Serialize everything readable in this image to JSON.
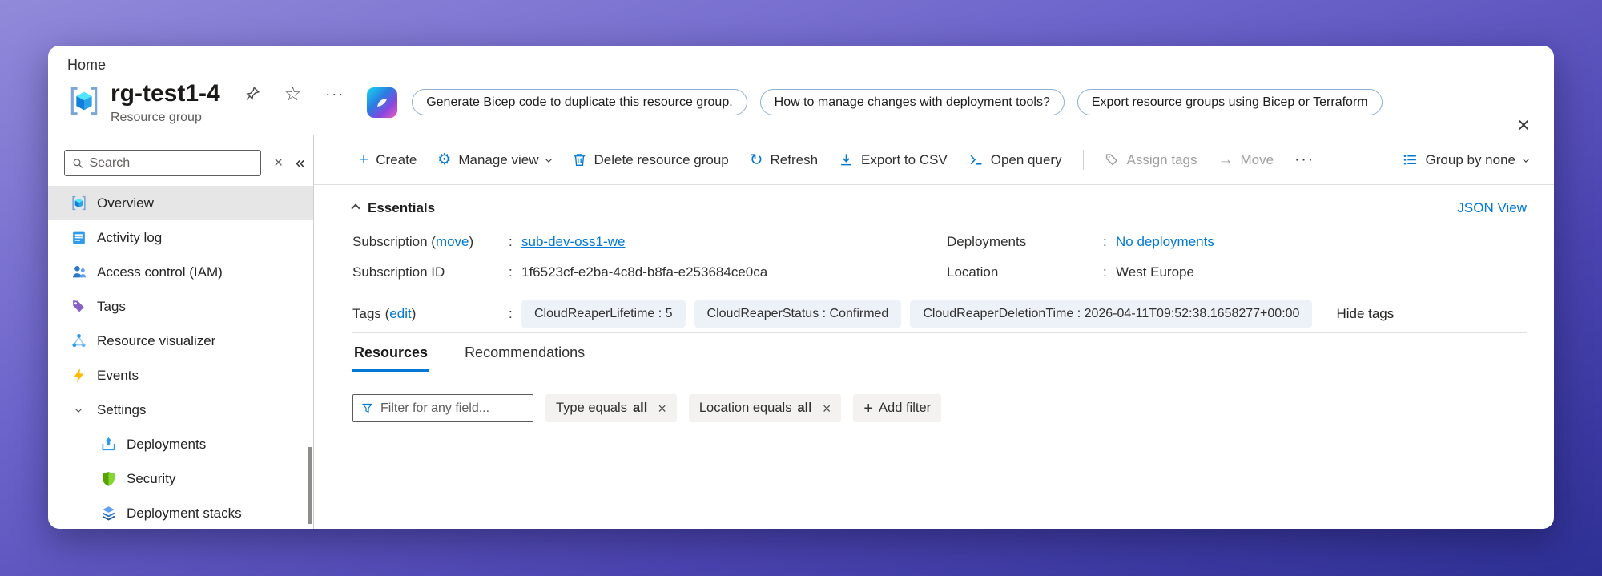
{
  "window": {
    "close_glyph": "×"
  },
  "breadcrumb": {
    "label": "Home"
  },
  "header": {
    "title": "rg-test1-4",
    "subtitle": "Resource group",
    "chips": [
      "Generate Bicep code to duplicate this resource group.",
      "How to manage changes with deployment tools?",
      "Export resource groups using Bicep or Terraform"
    ]
  },
  "glyphs": {
    "plus": "+",
    "gear": "⚙",
    "refresh": "↻",
    "star": "☆",
    "more": "···",
    "collapse": "«",
    "clear": "×",
    "move_arrow": "→"
  },
  "sidebar": {
    "search_placeholder": "Search",
    "items": [
      {
        "label": "Overview"
      },
      {
        "label": "Activity log"
      },
      {
        "label": "Access control (IAM)"
      },
      {
        "label": "Tags"
      },
      {
        "label": "Resource visualizer"
      },
      {
        "label": "Events"
      },
      {
        "label": "Settings"
      },
      {
        "label": "Deployments"
      },
      {
        "label": "Security"
      },
      {
        "label": "Deployment stacks"
      }
    ]
  },
  "toolbar": {
    "create": "Create",
    "manage_view": "Manage view",
    "delete": "Delete resource group",
    "refresh": "Refresh",
    "export_csv": "Export to CSV",
    "open_query": "Open query",
    "assign_tags": "Assign tags",
    "move": "Move",
    "group_by": "Group by none"
  },
  "essentials": {
    "title": "Essentials",
    "json_view": "JSON View",
    "colon": ":",
    "subscription": {
      "prefix": "Subscription (",
      "link": "move",
      "suffix": ")",
      "value": "sub-dev-oss1-we"
    },
    "subscription_id": {
      "label": "Subscription ID",
      "value": "1f6523cf-e2ba-4c8d-b8fa-e253684ce0ca"
    },
    "deployments": {
      "label": "Deployments",
      "value": "No deployments"
    },
    "location": {
      "label": "Location",
      "value": "West Europe"
    },
    "tags": {
      "prefix": "Tags (",
      "link": "edit",
      "suffix": ")",
      "pills": [
        "CloudReaperLifetime : 5",
        "CloudReaperStatus : Confirmed",
        "CloudReaperDeletionTime : 2026-04-11T09:52:38.1658277+00:00"
      ],
      "hide_label": "Hide tags"
    }
  },
  "tabs": [
    {
      "label": "Resources"
    },
    {
      "label": "Recommendations"
    }
  ],
  "filters": {
    "placeholder": "Filter for any field...",
    "pills": [
      {
        "prefix": "Type equals",
        "value": "all"
      },
      {
        "prefix": "Location equals",
        "value": "all"
      }
    ],
    "add_label": "Add filter"
  }
}
